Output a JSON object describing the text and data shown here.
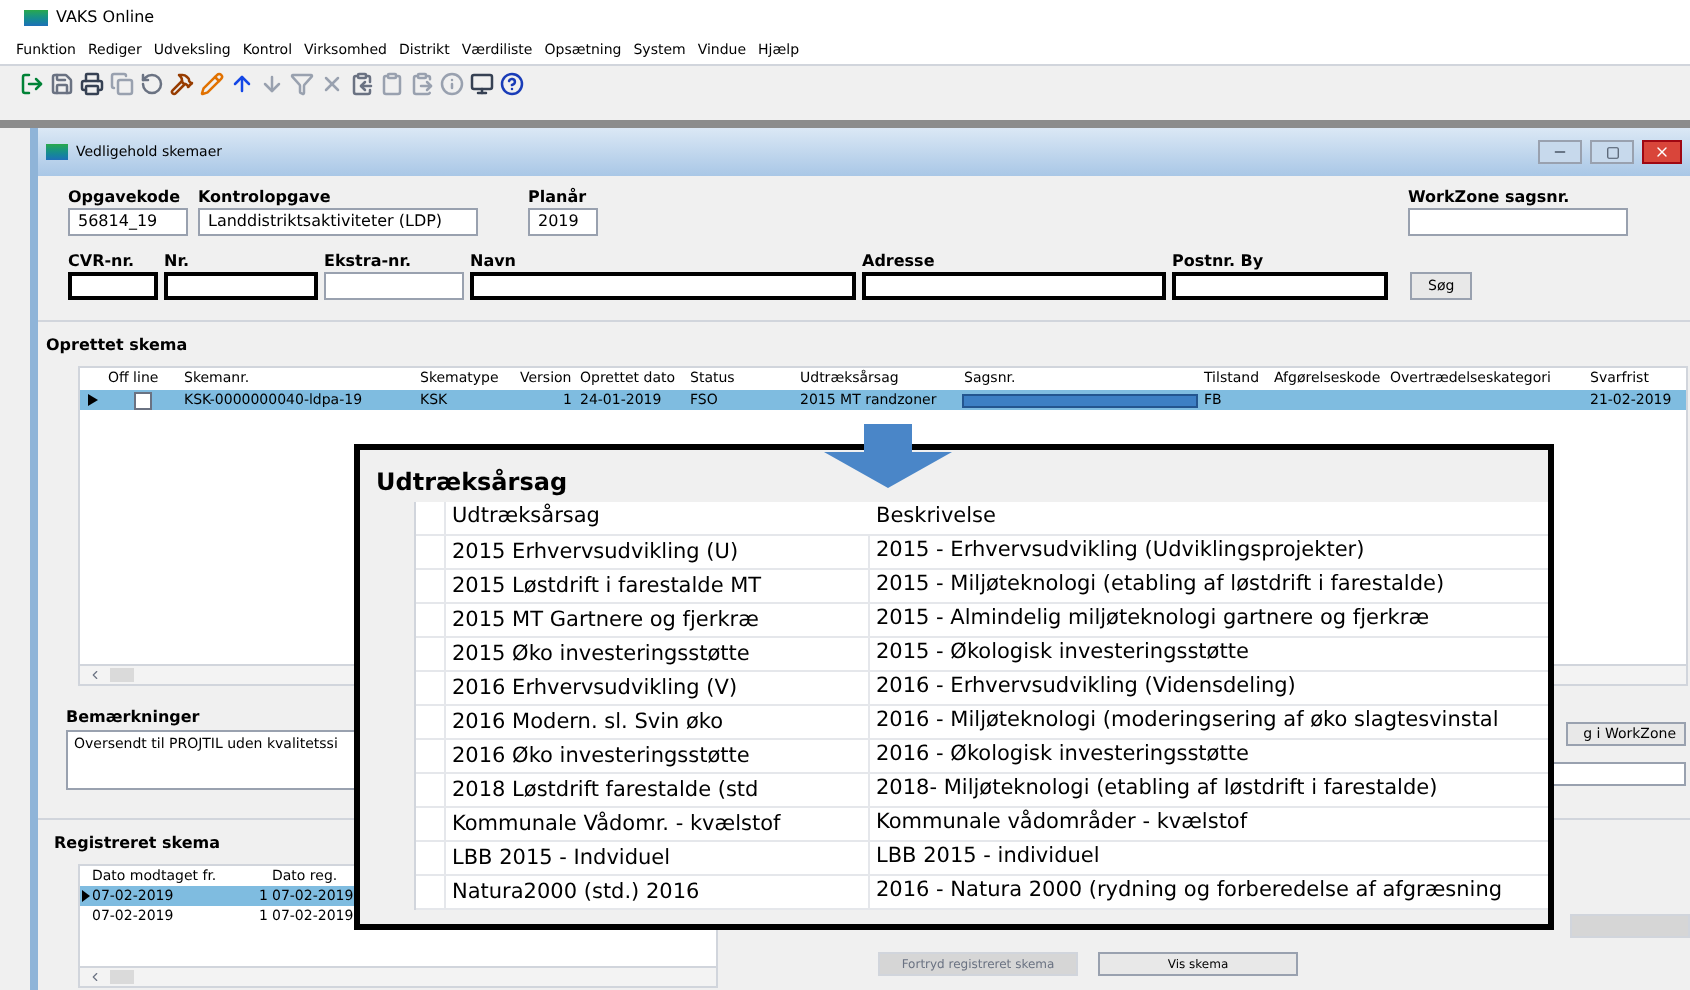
{
  "app": {
    "title": "VAKS Online"
  },
  "menu": [
    "Funktion",
    "Rediger",
    "Udveksling",
    "Kontrol",
    "Virksomhed",
    "Distrikt",
    "Værdiliste",
    "Opsætning",
    "System",
    "Vindue",
    "Hjælp"
  ],
  "window": {
    "title": "Vedligehold skemaer"
  },
  "form": {
    "row1": [
      {
        "label": "Opgavekode",
        "value": "56814_19",
        "required": false
      },
      {
        "label": "Kontrolopgave",
        "value": "Landdistriktsaktiviteter (LDP)",
        "required": false
      },
      {
        "label": "Planår",
        "value": "2019",
        "required": false
      },
      {
        "label": "WorkZone sagsnr.",
        "required": false
      }
    ],
    "row2": [
      {
        "label": "CVR-nr.",
        "required": true
      },
      {
        "label": "Nr.",
        "required": true
      },
      {
        "label": "Ekstra-nr.",
        "required": false
      },
      {
        "label": "Navn",
        "required": true
      },
      {
        "label": "Adresse",
        "required": true
      },
      {
        "label": "Postnr. By",
        "required": true
      }
    ],
    "search_button": "Søg"
  },
  "oprettet": {
    "title": "Oprettet skema",
    "offline_column": "Off line",
    "columns": [
      "Skemanr.",
      "Skematype",
      "Version",
      "Oprettet dato",
      "Status",
      "Udtræksårsag",
      "Sagsnr.",
      "Tilstand",
      "Afgørelseskode",
      "Overtrædelseskategori",
      "Svarfrist"
    ],
    "rows": [
      {
        "selected": true,
        "offline": false,
        "cells": [
          "KSK-0000000040-ldpa-19",
          "KSK",
          "1",
          "24-01-2019",
          "FSO",
          "2015 MT randzoner",
          "",
          "FB",
          "",
          "",
          "21-02-2019"
        ]
      }
    ]
  },
  "bemaerkninger": {
    "label": "Bemærkninger",
    "value": "Oversendt til PROJTIL uden kvalitetssi"
  },
  "workzone_button": "g i WorkZone",
  "registreret": {
    "title": "Registreret skema",
    "columns": [
      "Dato modtaget fr.",
      "",
      "Dato reg."
    ],
    "rows": [
      {
        "selected": true,
        "cells": [
          "07-02-2019",
          "1",
          "07-02-2019"
        ]
      },
      {
        "selected": false,
        "cells": [
          "07-02-2019",
          "1",
          "07-02-2019"
        ]
      }
    ]
  },
  "bottom_buttons": [
    {
      "label": "Fortryd registreret skema",
      "disabled": true
    },
    {
      "label": "Vis skema",
      "disabled": false
    }
  ],
  "popup": {
    "title": "Udtræksårsag",
    "columns": [
      "Udtræksårsag",
      "Beskrivelse"
    ],
    "rows": [
      [
        "2015 Erhvervsudvikling (U)",
        "2015 - Erhvervsudvikling (Udviklingsprojekter)"
      ],
      [
        "2015 Løstdrift i farestalde MT",
        "2015 - Miljøteknologi (etabling af løstdrift i farestalde)"
      ],
      [
        "2015 MT Gartnere og fjerkræ",
        "2015 - Almindelig miljøteknologi gartnere og fjerkræ"
      ],
      [
        "2015 Øko investeringsstøtte",
        "2015 - Økologisk investeringsstøtte"
      ],
      [
        "2016 Erhvervsudvikling (V)",
        "2016 - Erhvervsudvikling (Vidensdeling)"
      ],
      [
        "2016 Modern. sl. Svin øko",
        "2016 - Miljøteknologi (moderingsering af øko slagtesvinstal"
      ],
      [
        "2016 Øko investeringsstøtte",
        "2016 - Økologisk investeringsstøtte"
      ],
      [
        "2018 Løstdrift farestalde (std",
        "2018- Miljøteknologi (etabling af løstdrift i farestalde)"
      ],
      [
        "Kommunale Vådomr. - kvælstof",
        "Kommunale vådområder - kvælstof"
      ],
      [
        "LBB 2015 - Indviduel",
        "LBB 2015 - individuel"
      ],
      [
        "Natura2000 (std.) 2016",
        "2016 - Natura 2000 (rydning og forberedelse af afgræsning"
      ]
    ]
  }
}
